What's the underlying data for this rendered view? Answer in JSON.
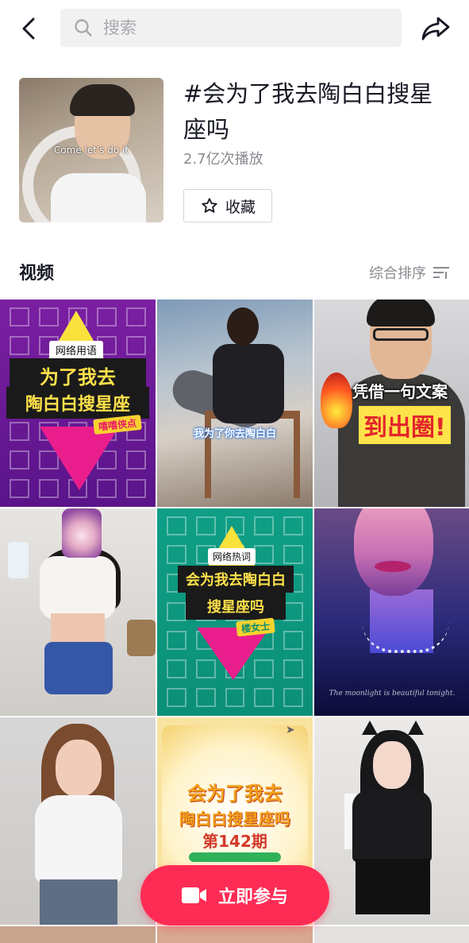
{
  "search": {
    "placeholder": "搜索"
  },
  "topic": {
    "title": "#会为了我去陶白白搜星座吗",
    "play_count": "2.7亿次播放",
    "favorite_label": "收藏",
    "cover_caption": "Come let's do it"
  },
  "section": {
    "title": "视频",
    "sort_label": "综合排序"
  },
  "videos": [
    {
      "id": 1,
      "tag": "网络用语",
      "line1": "为了我去",
      "line2": "陶白白搜星座",
      "line3": "嘻嘻侠点"
    },
    {
      "id": 2,
      "caption": "我为了你去陶白白"
    },
    {
      "id": 3,
      "line1": "凭借一句文案",
      "line2": "到出圈!"
    },
    {
      "id": 4
    },
    {
      "id": 5,
      "tag": "网络热词",
      "line1": "会为我去陶白白",
      "line2": "搜星座吗",
      "line3": "楼女士"
    },
    {
      "id": 6,
      "caption": "The moonlight is beautiful tonight."
    },
    {
      "id": 7
    },
    {
      "id": 8,
      "line1": "会为了我去",
      "line2": "陶白白搜星座吗",
      "line3": "第142期"
    },
    {
      "id": 9
    }
  ],
  "join_button": {
    "label": "立即参与"
  },
  "colors": {
    "accent": "#fe2c55",
    "text_primary": "#161823",
    "text_secondary": "#8a8b91"
  }
}
